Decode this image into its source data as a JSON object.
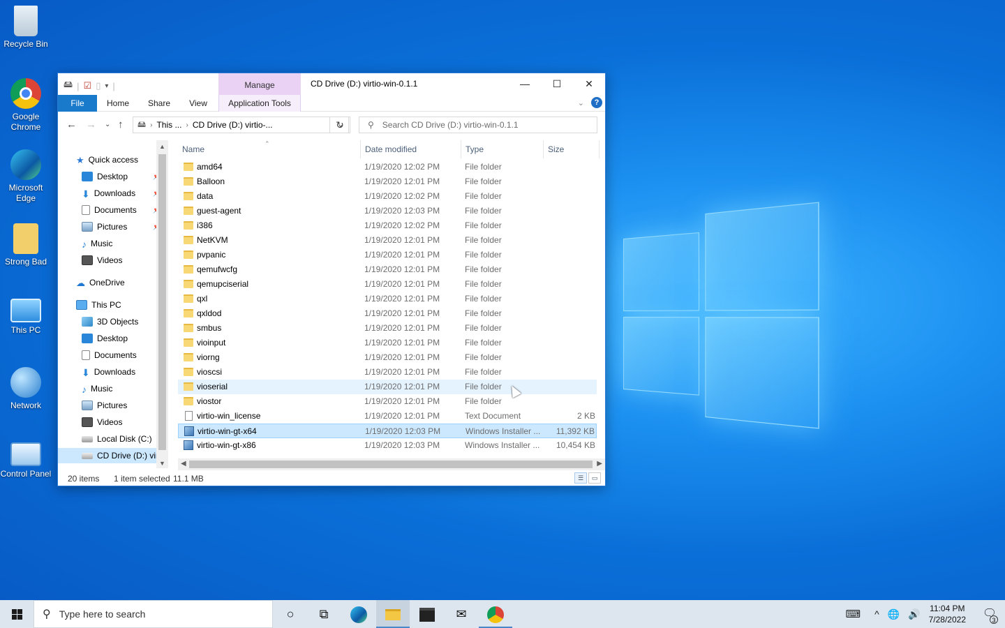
{
  "desktop": {
    "icons": [
      {
        "label": "Recycle Bin",
        "icon": "recycle-bin-icon"
      },
      {
        "label": "Google Chrome",
        "icon": "chrome-icon"
      },
      {
        "label": "Microsoft Edge",
        "icon": "edge-icon"
      },
      {
        "label": "Strong Bad",
        "icon": "user-folder-icon"
      },
      {
        "label": "This PC",
        "icon": "computer-icon"
      },
      {
        "label": "Network",
        "icon": "network-icon"
      },
      {
        "label": "Control Panel",
        "icon": "control-panel-icon"
      }
    ]
  },
  "window": {
    "title": "CD Drive (D:) virtio-win-0.1.1",
    "manage_tab": "Manage",
    "ribbon_tabs": {
      "file": "File",
      "home": "Home",
      "share": "Share",
      "view": "View",
      "app_tools": "Application Tools"
    },
    "address": {
      "crumb1": "This ...",
      "crumb2": "CD Drive (D:) virtio-..."
    },
    "search_placeholder": "Search CD Drive (D:) virtio-win-0.1.1",
    "columns": {
      "name": "Name",
      "date": "Date modified",
      "type": "Type",
      "size": "Size"
    },
    "status": {
      "count": "20 items",
      "selected": "1 item selected",
      "size": "11.1 MB"
    }
  },
  "nav": {
    "quick_access": "Quick access",
    "qa_items": [
      "Desktop",
      "Downloads",
      "Documents",
      "Pictures",
      "Music",
      "Videos"
    ],
    "onedrive": "OneDrive",
    "this_pc": "This PC",
    "pc_items": [
      "3D Objects",
      "Desktop",
      "Documents",
      "Downloads",
      "Music",
      "Pictures",
      "Videos",
      "Local Disk (C:)",
      "CD Drive (D:) virt"
    ]
  },
  "files": [
    {
      "name": "amd64",
      "date": "1/19/2020 12:02 PM",
      "type": "File folder",
      "size": "",
      "kind": "folder"
    },
    {
      "name": "Balloon",
      "date": "1/19/2020 12:01 PM",
      "type": "File folder",
      "size": "",
      "kind": "folder"
    },
    {
      "name": "data",
      "date": "1/19/2020 12:02 PM",
      "type": "File folder",
      "size": "",
      "kind": "folder"
    },
    {
      "name": "guest-agent",
      "date": "1/19/2020 12:03 PM",
      "type": "File folder",
      "size": "",
      "kind": "folder"
    },
    {
      "name": "i386",
      "date": "1/19/2020 12:02 PM",
      "type": "File folder",
      "size": "",
      "kind": "folder"
    },
    {
      "name": "NetKVM",
      "date": "1/19/2020 12:01 PM",
      "type": "File folder",
      "size": "",
      "kind": "folder"
    },
    {
      "name": "pvpanic",
      "date": "1/19/2020 12:01 PM",
      "type": "File folder",
      "size": "",
      "kind": "folder"
    },
    {
      "name": "qemufwcfg",
      "date": "1/19/2020 12:01 PM",
      "type": "File folder",
      "size": "",
      "kind": "folder"
    },
    {
      "name": "qemupciserial",
      "date": "1/19/2020 12:01 PM",
      "type": "File folder",
      "size": "",
      "kind": "folder"
    },
    {
      "name": "qxl",
      "date": "1/19/2020 12:01 PM",
      "type": "File folder",
      "size": "",
      "kind": "folder"
    },
    {
      "name": "qxldod",
      "date": "1/19/2020 12:01 PM",
      "type": "File folder",
      "size": "",
      "kind": "folder"
    },
    {
      "name": "smbus",
      "date": "1/19/2020 12:01 PM",
      "type": "File folder",
      "size": "",
      "kind": "folder"
    },
    {
      "name": "vioinput",
      "date": "1/19/2020 12:01 PM",
      "type": "File folder",
      "size": "",
      "kind": "folder"
    },
    {
      "name": "viorng",
      "date": "1/19/2020 12:01 PM",
      "type": "File folder",
      "size": "",
      "kind": "folder"
    },
    {
      "name": "vioscsi",
      "date": "1/19/2020 12:01 PM",
      "type": "File folder",
      "size": "",
      "kind": "folder"
    },
    {
      "name": "vioserial",
      "date": "1/19/2020 12:01 PM",
      "type": "File folder",
      "size": "",
      "kind": "folder",
      "state": "hover"
    },
    {
      "name": "viostor",
      "date": "1/19/2020 12:01 PM",
      "type": "File folder",
      "size": "",
      "kind": "folder"
    },
    {
      "name": "virtio-win_license",
      "date": "1/19/2020 12:01 PM",
      "type": "Text Document",
      "size": "2 KB",
      "kind": "doc"
    },
    {
      "name": "virtio-win-gt-x64",
      "date": "1/19/2020 12:03 PM",
      "type": "Windows Installer ...",
      "size": "11,392 KB",
      "kind": "msi",
      "state": "sel"
    },
    {
      "name": "virtio-win-gt-x86",
      "date": "1/19/2020 12:03 PM",
      "type": "Windows Installer ...",
      "size": "10,454 KB",
      "kind": "msi"
    }
  ],
  "taskbar": {
    "search_placeholder": "Type here to search",
    "time": "11:04 PM",
    "date": "7/28/2022",
    "notifications": "3"
  }
}
